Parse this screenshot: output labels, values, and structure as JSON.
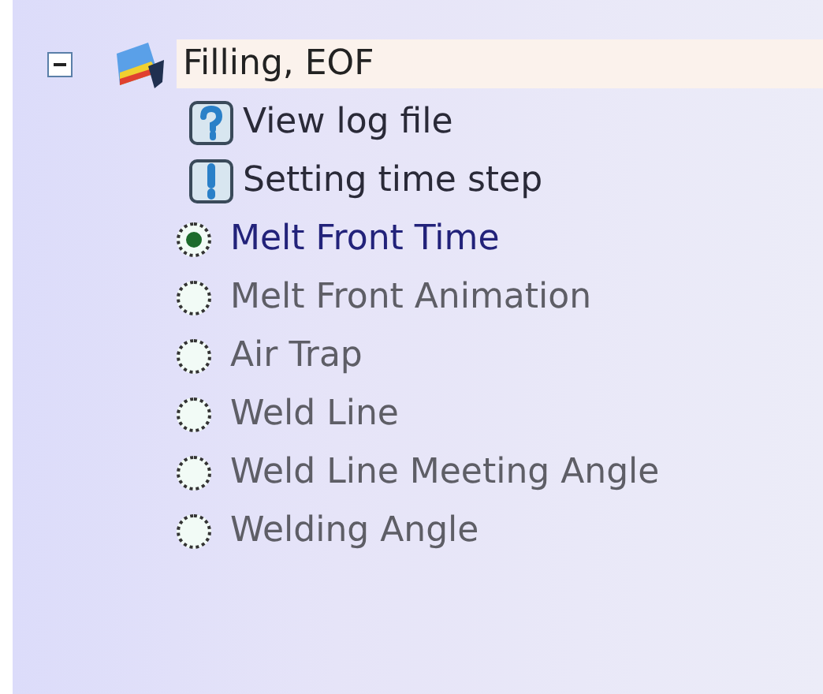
{
  "tree": [
    {
      "label": "Filling, EOF",
      "expanded": true,
      "selected": true,
      "children": [
        {
          "kind": "help",
          "label": "View log file"
        },
        {
          "kind": "notice",
          "label": "Setting time step"
        },
        {
          "kind": "radio",
          "label": "Melt Front Time",
          "selected": true
        },
        {
          "kind": "radio",
          "label": "Melt Front Animation",
          "selected": false
        },
        {
          "kind": "radio",
          "label": "Air Trap",
          "selected": false
        },
        {
          "kind": "radio",
          "label": "Weld Line",
          "selected": false
        },
        {
          "kind": "radio",
          "label": "Weld Line Meeting Angle",
          "selected": false
        },
        {
          "kind": "radio",
          "label": "Welding Angle",
          "selected": false
        }
      ]
    }
  ]
}
